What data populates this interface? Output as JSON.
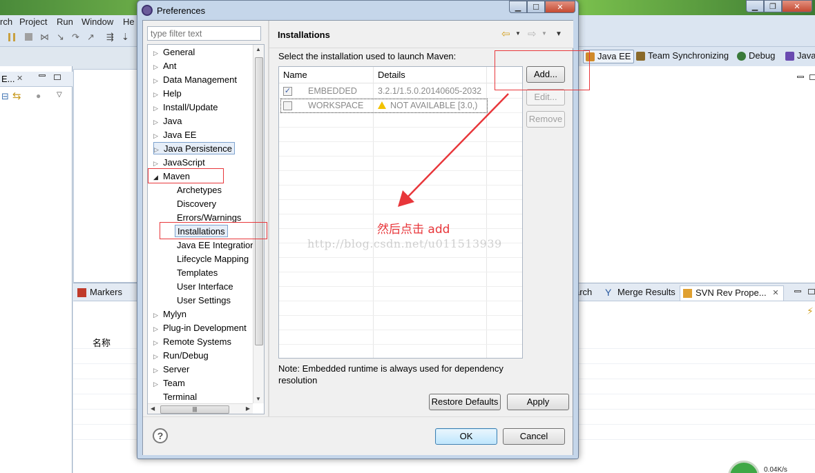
{
  "workbench": {
    "menu": [
      "rch",
      "Project",
      "Run",
      "Window",
      "He"
    ],
    "perspectives": [
      {
        "label": "Java EE",
        "active": true,
        "color": "#d08a2a"
      },
      {
        "label": "Team Synchronizing",
        "active": false,
        "color": "#8a6a2a"
      },
      {
        "label": "Debug",
        "active": false,
        "color": "#3a7a3a"
      },
      {
        "label": "Java",
        "active": false,
        "color": "#6a4ab0"
      }
    ],
    "left_view_tab": "E...",
    "bottom_tabs": {
      "markers": "Markers",
      "search_partial": "arch",
      "merge_results": "Merge Results",
      "svn_rev": "SVN Rev Prope..."
    },
    "bottom_column": "名称",
    "status_rate": "0.04K/s"
  },
  "dialog": {
    "title": "Preferences",
    "filter_placeholder": "type filter text",
    "tree": [
      {
        "label": "General",
        "expander": "▷"
      },
      {
        "label": "Ant",
        "expander": "▷"
      },
      {
        "label": "Data Management",
        "expander": "▷"
      },
      {
        "label": "Help",
        "expander": "▷"
      },
      {
        "label": "Install/Update",
        "expander": "▷"
      },
      {
        "label": "Java",
        "expander": "▷"
      },
      {
        "label": "Java EE",
        "expander": "▷"
      },
      {
        "label": "Java Persistence",
        "expander": "▷"
      },
      {
        "label": "JavaScript",
        "expander": "▷"
      },
      {
        "label": "Maven",
        "expander": "◢"
      },
      {
        "label": "Archetypes",
        "expander": ""
      },
      {
        "label": "Discovery",
        "expander": ""
      },
      {
        "label": "Errors/Warnings",
        "expander": ""
      },
      {
        "label": "Installations",
        "expander": ""
      },
      {
        "label": "Java EE Integration",
        "expander": ""
      },
      {
        "label": "Lifecycle Mapping",
        "expander": ""
      },
      {
        "label": "Templates",
        "expander": ""
      },
      {
        "label": "User Interface",
        "expander": ""
      },
      {
        "label": "User Settings",
        "expander": ""
      },
      {
        "label": "Mylyn",
        "expander": "▷"
      },
      {
        "label": "Plug-in Development",
        "expander": "▷"
      },
      {
        "label": "Remote Systems",
        "expander": "▷"
      },
      {
        "label": "Run/Debug",
        "expander": "▷"
      },
      {
        "label": "Server",
        "expander": "▷"
      },
      {
        "label": "Team",
        "expander": "▷"
      },
      {
        "label": "Terminal",
        "expander": ""
      }
    ],
    "page": {
      "title": "Installations",
      "instructions": "Select the installation used to launch Maven:",
      "columns": [
        "Name",
        "Details"
      ],
      "rows": [
        {
          "checked": true,
          "checkmark": "✓",
          "name": "EMBEDDED",
          "details": "3.2.1/1.5.0.20140605-2032",
          "warning": false
        },
        {
          "checked": false,
          "checkmark": "",
          "name": "WORKSPACE",
          "details": "NOT AVAILABLE [3.0,)",
          "warning": true
        }
      ],
      "buttons": {
        "add": "Add...",
        "edit": "Edit...",
        "remove": "Remove"
      },
      "note": "Note: Embedded runtime is always used for dependency resolution",
      "restore_defaults": "Restore Defaults",
      "apply": "Apply"
    },
    "footer": {
      "help": "?",
      "ok": "OK",
      "cancel": "Cancel"
    }
  },
  "annotation": {
    "text": "然后点击 add",
    "color": "#e8363a",
    "watermark": "http://blog.csdn.net/u011513939"
  }
}
